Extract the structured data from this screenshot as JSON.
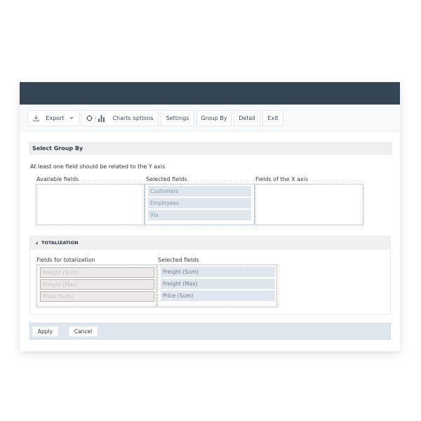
{
  "toolbar": {
    "export_label": "Export",
    "export_icon": "download-icon",
    "charts_options_label": "Charts options",
    "charts_options_icons": [
      "gear-icon",
      "bar-chart-icon"
    ],
    "settings_label": "Settings",
    "group_by_label": "Group By",
    "detail_label": "Detail",
    "exit_label": "Exit"
  },
  "group_by": {
    "title": "Select Group By",
    "hint": "At least one field should be related to the Y axis",
    "available_label": "Available fields",
    "available_fields": [],
    "selected_label": "Selected fields",
    "selected_fields": [
      "Customers",
      "Employees",
      "Via"
    ],
    "x_axis_label": "Fields of the X axis",
    "x_axis_fields": []
  },
  "totalization": {
    "title": "TOTALIZATION",
    "fields_label": "Fields for totalization",
    "fields": [
      "Freight (Sum)",
      "Freight (Max)",
      "Price (Sum)"
    ],
    "selected_label": "Selected fields",
    "selected_fields": [
      "Freight (Sum)",
      "Freight (Max)",
      "Price (Sum)"
    ]
  },
  "footer": {
    "apply_label": "Apply",
    "cancel_label": "Cancel"
  },
  "colors": {
    "topbar": "#344556",
    "selected_item_bg": "#dfe6ee",
    "disabled_item_bg": "#ece9e8",
    "footer_bg": "#dfe6ee"
  }
}
